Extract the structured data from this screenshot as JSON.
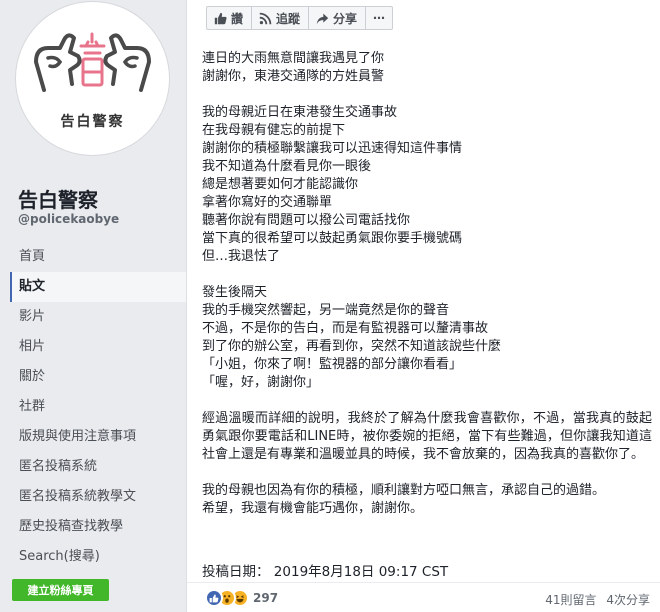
{
  "sidebar": {
    "avatar_caption": "告白警察",
    "page_name": "告白警察",
    "page_handle": "@policekaobye",
    "nav": [
      "首頁",
      "貼文",
      "影片",
      "相片",
      "關於",
      "社群",
      "版規與使用注意事項",
      "匿名投稿系統",
      "匿名投稿系統教學文",
      "歷史投稿查找教學",
      "Search(搜尋)"
    ],
    "active_nav_index": 1,
    "create_page_label": "建立粉絲專頁"
  },
  "actions": {
    "like": "讚",
    "follow": "追蹤",
    "share": "分享",
    "more": "⋯"
  },
  "post": {
    "paragraphs": [
      [
        "連日的大雨無意間讓我遇見了你",
        "謝謝你，東港交通隊的方姓員警"
      ],
      [
        "我的母親近日在東港發生交通事故",
        "在我母親有健忘的前提下",
        "謝謝你的積極聯繫讓我可以迅速得知這件事情",
        "我不知道為什麼看見你一眼後",
        "總是想著要如何才能認識你",
        "拿著你寫好的交通聯單",
        "聽著你說有問題可以撥公司電話找你",
        "當下真的很希望可以鼓起勇氣跟你要手機號碼",
        "但…我退怯了"
      ],
      [
        "發生後隔天",
        "我的手機突然響起，另一端竟然是你的聲音",
        "不過，不是你的告白，而是有監視器可以釐清事故",
        "到了你的辦公室，再看到你，突然不知道該說些什麼",
        "「小姐，你來了啊！監視器的部分讓你看看」",
        "「喔，好，謝謝你」"
      ],
      [
        "經過溫暖而詳細的說明，我終於了解為什麼我會喜歡你，不過，當我真的鼓起勇氣跟你要電話和LINE時，被你委婉的拒絕，當下有些難過，但你讓我知道這社會上還是有專業和溫暖並具的時候，我不會放棄的，因為我真的喜歡你了。"
      ],
      [
        "我的母親也因為有你的積極，順利讓對方啞口無言，承認自己的過錯。",
        "希望，我還有機會能巧遇你，謝謝你。"
      ]
    ],
    "post_date_label": "投稿日期：",
    "post_date_value": "2019年8月18日 09:17 CST"
  },
  "footer": {
    "reaction_count": "297",
    "comments": "41則留言",
    "shares": "4次分享",
    "reaction_icons": [
      "like-reaction",
      "wow-reaction",
      "haha-reaction"
    ]
  },
  "colors": {
    "fb_blue": "#4267b2",
    "green_button": "#42b72a",
    "logo_pink": "#e8748b"
  }
}
